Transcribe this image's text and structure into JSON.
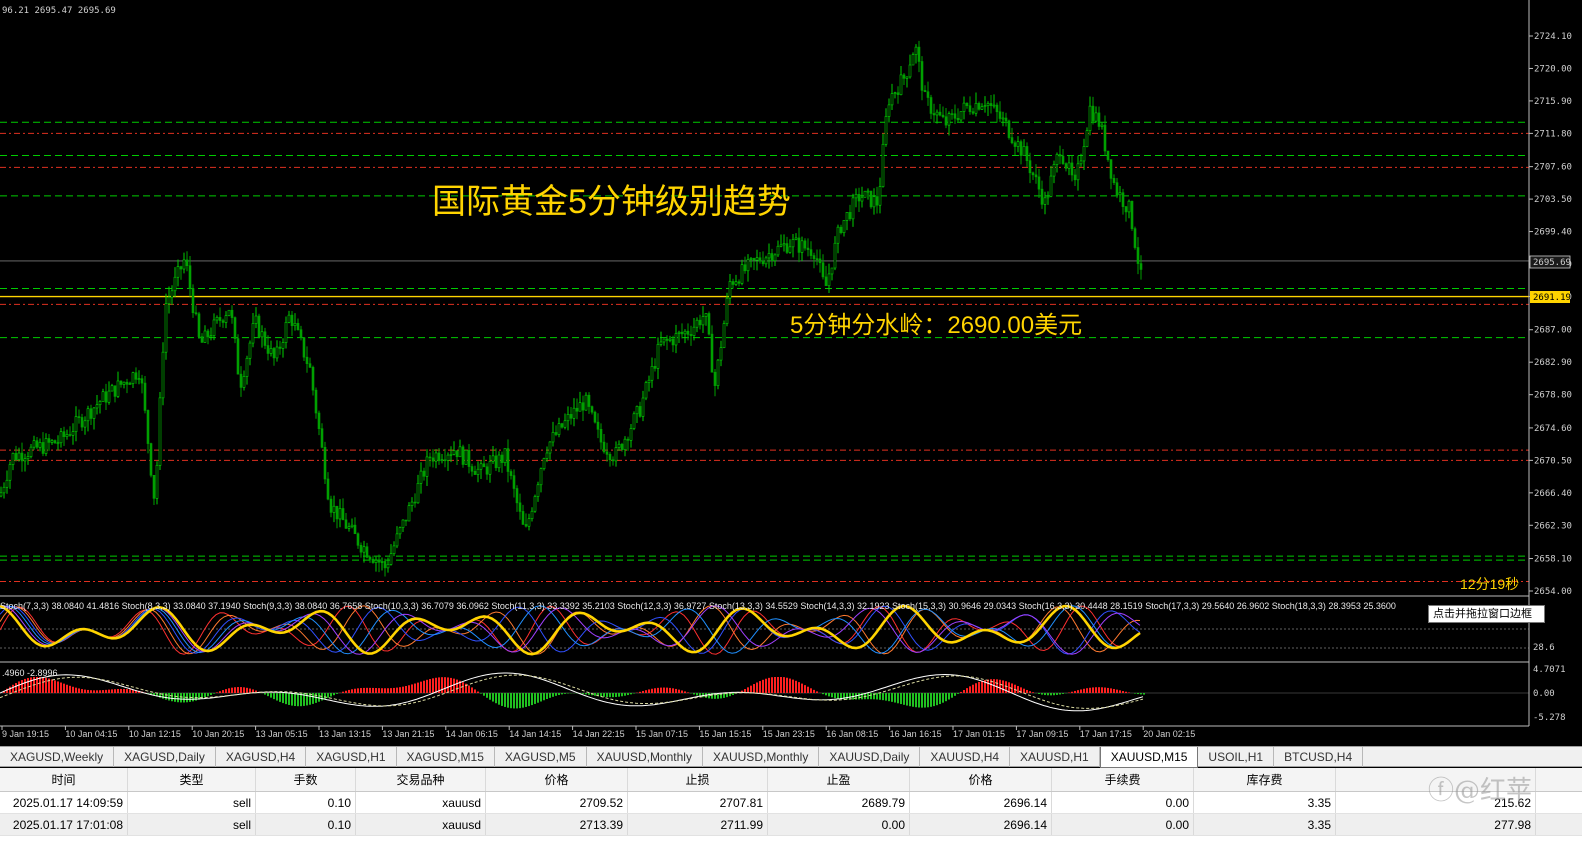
{
  "chart": {
    "ohlc_text": "96.21 2695.47 2695.69",
    "title": "国际黄金5分钟级别趋势",
    "note": "5分钟分水岭：2690.00美元",
    "countdown": "12分19秒",
    "current_price": "2695.69",
    "line_price": "2691.19",
    "price_ticks": [
      "2724.10",
      "2720.00",
      "2715.90",
      "2711.80",
      "2707.60",
      "2703.50",
      "2699.40",
      "2695.30",
      "2691.20",
      "2687.00",
      "2682.90",
      "2678.80",
      "2674.60",
      "2670.50",
      "2666.40",
      "2662.30",
      "2658.10",
      "2654.00"
    ],
    "time_ticks": [
      "9 Jan 19:15",
      "10 Jan 04:15",
      "10 Jan 12:15",
      "10 Jan 20:15",
      "13 Jan 05:15",
      "13 Jan 13:15",
      "13 Jan 21:15",
      "14 Jan 06:15",
      "14 Jan 14:15",
      "14 Jan 22:15",
      "15 Jan 07:15",
      "15 Jan 15:15",
      "15 Jan 23:15",
      "16 Jan 08:15",
      "16 Jan 16:15",
      "17 Jan 01:15",
      "17 Jan 09:15",
      "17 Jan 17:15",
      "20 Jan 02:15"
    ],
    "colors": {
      "bull": "#00d000",
      "bear": "#00a000",
      "green_level": "#00cc00",
      "red_level": "#e03020",
      "yellow_level": "#ffd400",
      "title": "#ffd400"
    }
  },
  "stoch": {
    "label": "Stoch(7,3,3) 38.0840 41.4816  Stoch(8,3,3) 33.0840 37.1940  Stoch(9,3,3) 38.0840 36.7658  Stoch(10,3,3) 36.7079 36.0962  Stoch(11,3,3) 33.3392 35.2103  Stoch(12,3,3) 36.9727  Stoch(13,3,3) 34.5529  Stoch(14,3,3) 32.1923  Stoch(15,3,3) 30.9646 29.0343  Stoch(16,3,3) 30.4448 28.1519  Stoch(17,3,3) 29.5640 26.9602  Stoch(18,3,3) 28.3953 25.3600",
    "tick": "28.6"
  },
  "macd": {
    "label": ".4960 -2.8996",
    "ticks": [
      "4.7071",
      "0.00",
      "-5.278"
    ]
  },
  "tooltip": "点击并拖拉窗口边框",
  "tabs": [
    "XAGUSD,Weekly",
    "XAGUSD,Daily",
    "XAGUSD,H4",
    "XAGUSD,H1",
    "XAGUSD,M15",
    "XAGUSD,M5",
    "XAUUSD,Monthly",
    "XAUUSD,Monthly",
    "XAUUSD,Daily",
    "XAUUSD,H4",
    "XAUUSD,H1",
    "XAUUSD,M15",
    "USOIL,H1",
    "BTCUSD,H4"
  ],
  "active_tab": 11,
  "orders": {
    "headers": [
      "时间",
      "类型",
      "手数",
      "交易品种",
      "价格",
      "止损",
      "止盈",
      "价格",
      "手续费",
      "库存费",
      ""
    ],
    "rows": [
      [
        "2025.01.17 14:09:59",
        "sell",
        "0.10",
        "xauusd",
        "2709.52",
        "2707.81",
        "2689.79",
        "2696.14",
        "0.00",
        "3.35",
        "215.62"
      ],
      [
        "2025.01.17 17:01:08",
        "sell",
        "0.10",
        "xauusd",
        "2713.39",
        "2711.99",
        "0.00",
        "2696.14",
        "0.00",
        "3.35",
        "277.98"
      ]
    ]
  },
  "watermark": "@红苹"
}
